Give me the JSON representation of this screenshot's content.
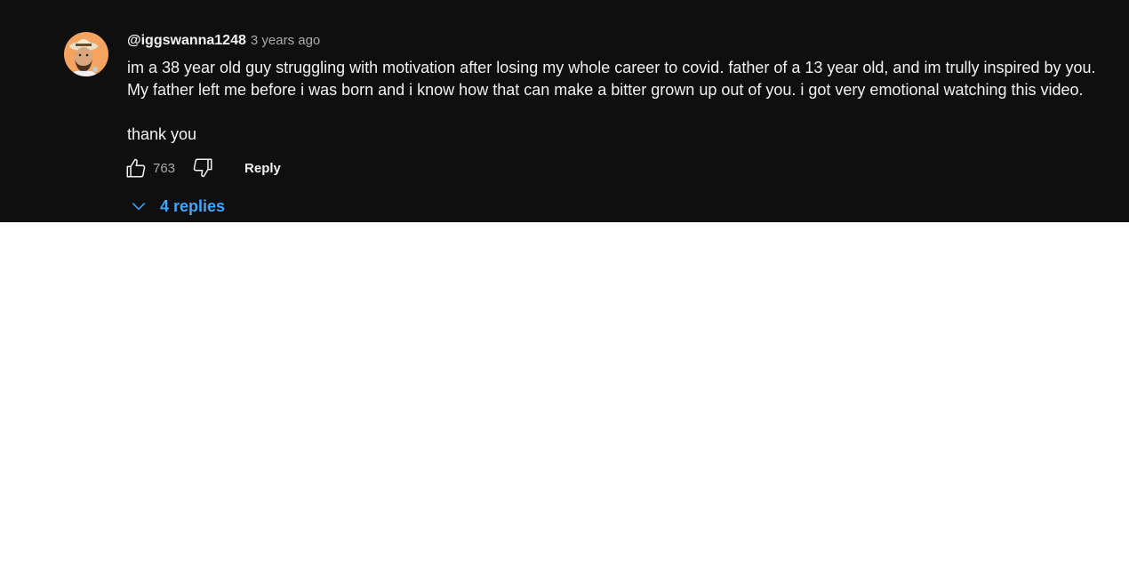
{
  "comment": {
    "author": "@iggswanna1248",
    "timestamp": "3 years ago",
    "text": "im a 38 year old guy struggling with motivation after losing my whole career to covid. father of a 13 year old, and im trully inspired by you. My father left me before i was born and i know how that can make a bitter grown up out of you. i got very emotional watching this video.\n\nthank you",
    "like_count": "763",
    "reply_label": "Reply",
    "replies_toggle_label": "4 replies",
    "icons": {
      "like": "thumbs-up-icon",
      "dislike": "thumbs-down-icon",
      "expand": "chevron-down-icon"
    }
  },
  "colors": {
    "background": "#0f0f0f",
    "text": "#f1f1f1",
    "secondary_text": "#aaaaaa",
    "link": "#3ea6ff",
    "avatar_bg": "#f4a460"
  }
}
